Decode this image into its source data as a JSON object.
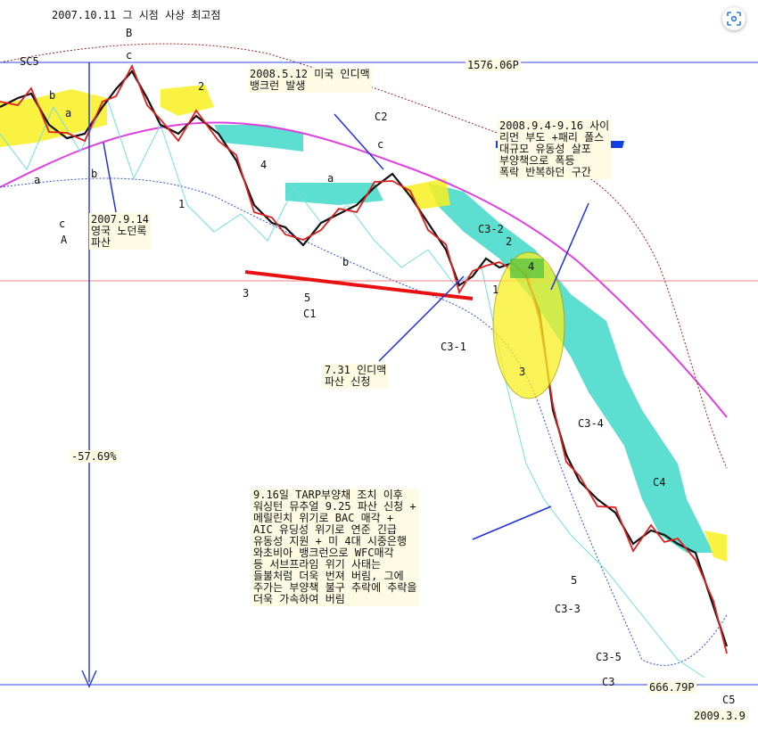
{
  "chart_data": {
    "type": "line",
    "title": "2007.10.11 그 시점 사상 최고점",
    "top_level": {
      "value": 1576.06,
      "label": "1576.06P"
    },
    "bottom_level": {
      "value": 666.79,
      "label": "666.79P"
    },
    "end_date": "2009.3.9",
    "decline_pct": "-57.69%",
    "wave_labels": [
      "SC5",
      "B",
      "c",
      "2",
      "b",
      "a",
      "a",
      "b",
      "c",
      "A",
      "1",
      "4",
      "3",
      "5",
      "C1",
      "C2",
      "c",
      "a",
      "b",
      "C3-2",
      "2",
      "4",
      "1",
      "3",
      "C3-1",
      "C3-4",
      "5",
      "C3-3",
      "C4",
      "C3-5",
      "C3",
      "C5"
    ],
    "annotations": [
      "2008.5.12 미국 인디맥\n뱅크런 발생",
      "2008.9.4-9.16 사이\n리먼 부도 +패리 폴스\n대규모 유동성 살포\n부양책으로 폭등\n폭락 반복하던 구간",
      "2007.9.14\n영국 노던록\n파산",
      "7.31 인디맥\n파산 신청",
      "9.16일 TARP부양채 조치 이후\n워싱턴 뮤추얼 9.25 파산 신청 +\n메릴린치 위기로 BAC 매각 +\nAIC 유딩성 위기로 연준 긴급\n유동성 지원 + 미 4대 시중은행\n와초비아 뱅크런으로 WFC매각\n등 서브프라임 위기 사태는\n들불처럼 더욱 번져 버림, 그에\n주가는 부양책 불구 추락에 추락을\n더욱 가속하여 버림"
    ]
  },
  "colors": {
    "price": "#111111",
    "conversion": "#e02020",
    "ma_long": "#e040e0",
    "cloud_up": "#40d8c8",
    "cloud_down": "#f8f020",
    "band": "#a02020",
    "level": "#3040e0",
    "trend": "#e81010",
    "lagging": "#70e0e0"
  },
  "ui": {
    "scan_icon": "scan-icon"
  }
}
